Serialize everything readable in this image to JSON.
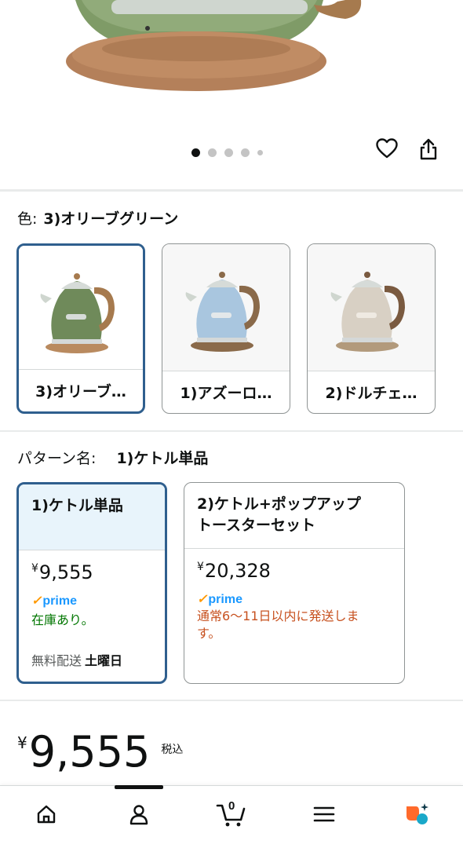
{
  "gallery": {
    "dot_count": 5,
    "active_index": 0,
    "wishlist_icon": "heart-icon",
    "share_icon": "share-icon"
  },
  "color_selector": {
    "label": "色:",
    "selected_value": "3)オリーブグリーン",
    "options": [
      {
        "label": "3)オリーブ…",
        "body_color": "#6f8a5a",
        "selected": true
      },
      {
        "label": "1)アズーロ…",
        "body_color": "#a9c6df",
        "selected": false
      },
      {
        "label": "2)ドルチェ…",
        "body_color": "#d8d0c4",
        "selected": false
      }
    ]
  },
  "pattern_selector": {
    "label": "パターン名:",
    "selected_value": "1)ケトル単品",
    "options": [
      {
        "name": "1)ケトル単品",
        "yen": "¥",
        "price": "9,555",
        "prime": "prime",
        "availability": "在庫あり。",
        "delivery_label": "無料配送",
        "delivery_day": "土曜日",
        "selected": true
      },
      {
        "name_line1": "2)ケトル+ポップアップ",
        "name_line2": "トースターセット",
        "yen": "¥",
        "price": "20,328",
        "prime": "prime",
        "availability_line1": "通常6～11日以内に発送しま",
        "availability_line2": "す。",
        "selected": false
      }
    ]
  },
  "price": {
    "yen": "¥",
    "amount": "9,555",
    "tax_label": "税込"
  },
  "bottom_nav": {
    "items": [
      "home-icon",
      "account-icon",
      "cart-icon",
      "menu-icon",
      "rufus-icon"
    ],
    "cart_count": "0",
    "active_index": 1
  }
}
